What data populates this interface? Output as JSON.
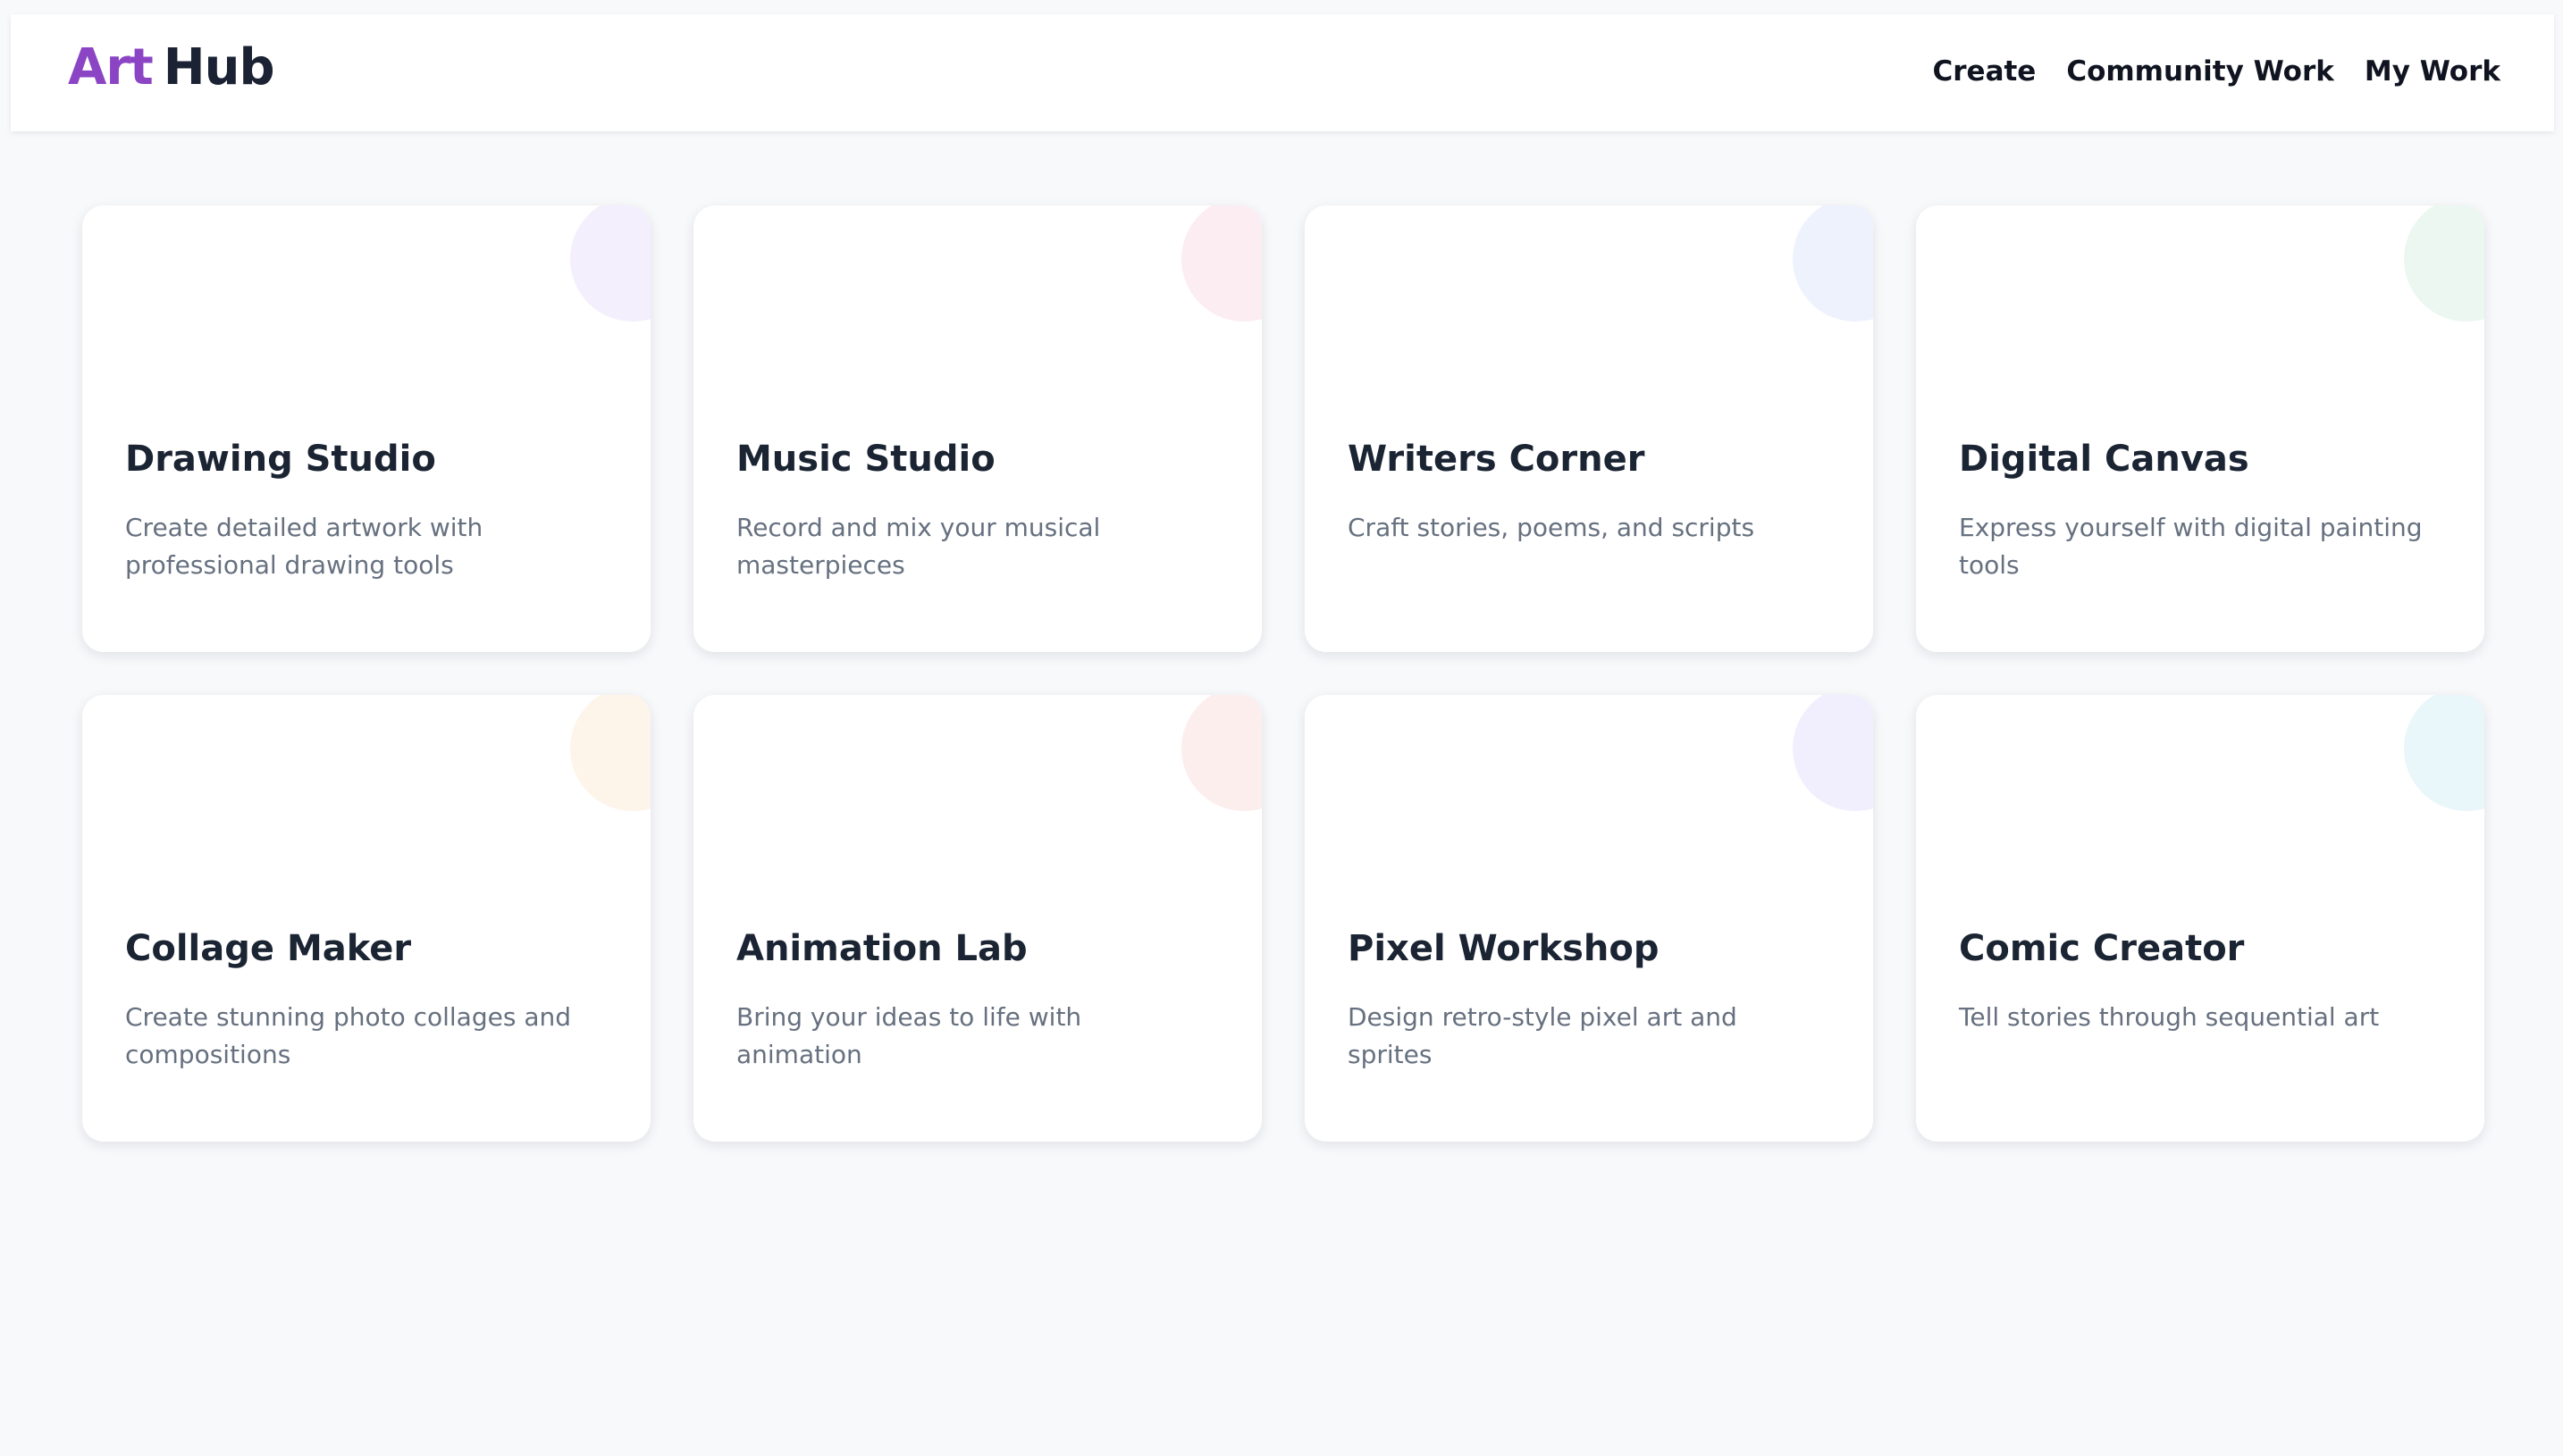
{
  "header": {
    "logo_part1": "Art",
    "logo_part2": "Hub",
    "nav": [
      {
        "label": "Create"
      },
      {
        "label": "Community Work"
      },
      {
        "label": "My Work"
      }
    ]
  },
  "cards": [
    {
      "title": "Drawing Studio",
      "description": "Create detailed artwork with professional drawing tools",
      "accent": "#f3effc"
    },
    {
      "title": "Music Studio",
      "description": "Record and mix your musical masterpieces",
      "accent": "#fcedf3"
    },
    {
      "title": "Writers Corner",
      "description": "Craft stories, poems, and scripts",
      "accent": "#eef2fd"
    },
    {
      "title": "Digital Canvas",
      "description": "Express yourself with digital painting tools",
      "accent": "#ebf7f0"
    },
    {
      "title": "Collage Maker",
      "description": "Create stunning photo collages and compositions",
      "accent": "#fdf4ea"
    },
    {
      "title": "Animation Lab",
      "description": "Bring your ideas to life with animation",
      "accent": "#fdeeee"
    },
    {
      "title": "Pixel Workshop",
      "description": "Design retro-style pixel art and sprites",
      "accent": "#f1effd"
    },
    {
      "title": "Comic Creator",
      "description": "Tell stories through sequential art",
      "accent": "#e9f6fa"
    }
  ]
}
